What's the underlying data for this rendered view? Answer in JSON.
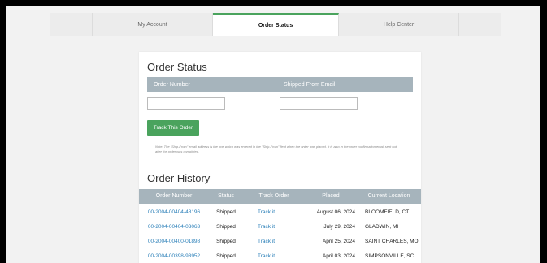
{
  "tabs": [
    {
      "label": ""
    },
    {
      "label": "My Account"
    },
    {
      "label": "Order Status"
    },
    {
      "label": "Help Center"
    },
    {
      "label": ""
    }
  ],
  "order_status": {
    "title": "Order Status",
    "col_order_number": "Order Number",
    "col_shipped_from": "Shipped From Email",
    "order_number_value": "",
    "email_value": "",
    "track_button": "Track This Order",
    "note": "Note: The \"Ship-From\" email address is the one which was entered in the \"Ship-From\" field when the order was placed. It is also in the order confirmation email sent out after the order was completed."
  },
  "order_history": {
    "title": "Order History",
    "columns": [
      "Order Number",
      "Status",
      "Track Order",
      "Placed",
      "Current Location"
    ],
    "rows": [
      {
        "order": "00-2004-00404-48196",
        "status": "Shipped",
        "track": "Track it",
        "placed": "August 06, 2024",
        "location": "BLOOMFIELD, CT"
      },
      {
        "order": "00-2004-00404-03063",
        "status": "Shipped",
        "track": "Track it",
        "placed": "July 29, 2024",
        "location": "GLADWIN, MI"
      },
      {
        "order": "00-2004-00400-01898",
        "status": "Shipped",
        "track": "Track it",
        "placed": "April 25, 2024",
        "location": "SAINT CHARLES, MO"
      },
      {
        "order": "00-2004-00398-93952",
        "status": "Shipped",
        "track": "Track it",
        "placed": "April 03, 2024",
        "location": "SIMPSONVILLE, SC"
      }
    ]
  },
  "colors": {
    "accent_green": "#4aa35d",
    "header_gray": "#a6b4bc",
    "link_blue": "#2a7fb8"
  }
}
